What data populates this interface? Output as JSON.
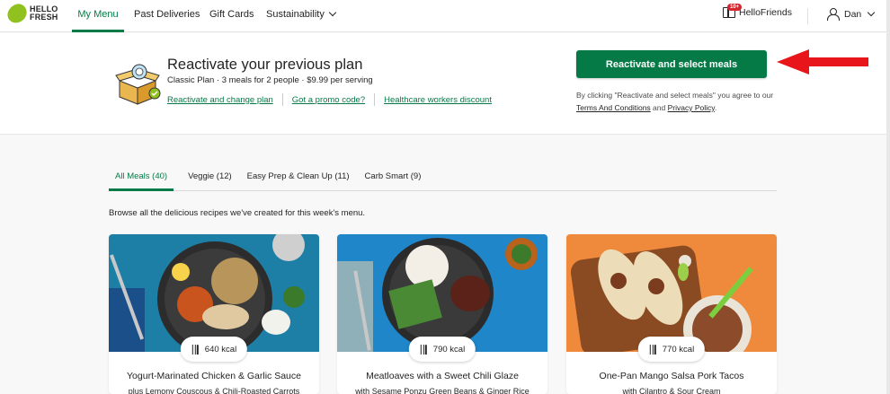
{
  "nav": {
    "logo": "HELLO FRESH",
    "items": [
      {
        "label": "My Menu",
        "active": true
      },
      {
        "label": "Past Deliveries"
      },
      {
        "label": "Gift Cards"
      },
      {
        "label": "Sustainability"
      }
    ],
    "friends_badge": "10+",
    "friends_label": "HelloFriends",
    "user_name": "Dan"
  },
  "banner": {
    "title": "Reactivate your previous plan",
    "subtitle": "Classic Plan · 3 meals for 2 people · $9.99 per serving",
    "links": [
      "Reactivate and change plan",
      "Got a promo code?",
      "Healthcare workers discount"
    ],
    "cta_label": "Reactivate and select meals",
    "legal_prefix": "By clicking \"Reactivate and select meals\" you agree to our ",
    "terms_label": "Terms And Conditions",
    "legal_and": " and ",
    "privacy_label": "Privacy Policy",
    "legal_suffix": "."
  },
  "tabs": [
    {
      "label": "All Meals (40)",
      "active": true
    },
    {
      "label": "Veggie (12)"
    },
    {
      "label": "Easy Prep & Clean Up (11)"
    },
    {
      "label": "Carb Smart (9)"
    }
  ],
  "browse_text": "Browse all the delicious recipes we've created for this week's menu.",
  "cards": [
    {
      "kcal": "640 kcal",
      "title": "Yogurt-Marinated Chicken & Garlic Sauce",
      "subtitle": "plus Lemony Couscous & Chili-Roasted Carrots"
    },
    {
      "kcal": "790 kcal",
      "title": "Meatloaves with a Sweet Chili Glaze",
      "subtitle": "with Sesame Ponzu Green Beans & Ginger Rice"
    },
    {
      "kcal": "770 kcal",
      "title": "One-Pan Mango Salsa Pork Tacos",
      "subtitle": "with Cilantro & Sour Cream"
    }
  ],
  "colors": {
    "brand_green": "#067a46",
    "logo_green": "#91c11e",
    "arrow_red": "#e8161b"
  }
}
